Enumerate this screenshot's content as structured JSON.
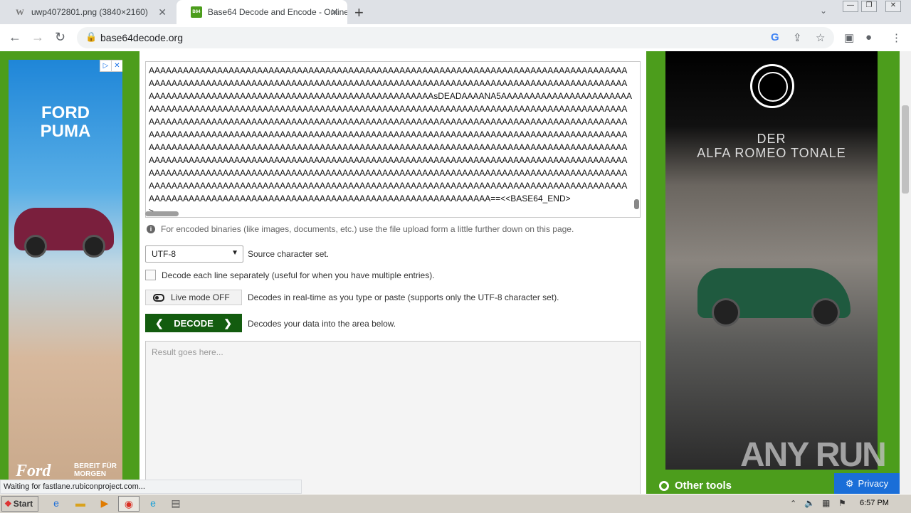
{
  "browser": {
    "tabs": [
      {
        "title": "uwp4072801.png (3840×2160)",
        "favicon": "W"
      },
      {
        "title": "Base64 Decode and Encode - Online",
        "favicon": "B64"
      }
    ],
    "url": "base64decode.org",
    "status_text": "Waiting for fastlane.rubiconproject.com..."
  },
  "editor": {
    "lines": [
      "AAAAAAAAAAAAAAAAAAAAAAAAAAAAAAAAAAAAAAAAAAAAAAAAAAAAAAAAAAAAAAAAAAAAAAAAAAAAAAAAAAAA",
      "AAAAAAAAAAAAAAAAAAAAAAAAAAAAAAAAAAAAAAAAAAAAAAAAAAAAAAAAAAAAAAAAAAAAAAAAAAAAAAAAAAAA",
      "AAAAAAAAAAAAAAAAAAAAAAAAAAAAAAAAAAAAAAAAAAAAAAAAAAsDEADAAAANA5AAAAAAAAAAAAAAAAAAAAAAA",
      "AAAAAAAAAAAAAAAAAAAAAAAAAAAAAAAAAAAAAAAAAAAAAAAAAAAAAAAAAAAAAAAAAAAAAAAAAAAAAAAAAAAA",
      "AAAAAAAAAAAAAAAAAAAAAAAAAAAAAAAAAAAAAAAAAAAAAAAAAAAAAAAAAAAAAAAAAAAAAAAAAAAAAAAAAAAA",
      "AAAAAAAAAAAAAAAAAAAAAAAAAAAAAAAAAAAAAAAAAAAAAAAAAAAAAAAAAAAAAAAAAAAAAAAAAAAAAAAAAAAA",
      "AAAAAAAAAAAAAAAAAAAAAAAAAAAAAAAAAAAAAAAAAAAAAAAAAAAAAAAAAAAAAAAAAAAAAAAAAAAAAAAAAAAA",
      "AAAAAAAAAAAAAAAAAAAAAAAAAAAAAAAAAAAAAAAAAAAAAAAAAAAAAAAAAAAAAAAAAAAAAAAAAAAAAAAAAAAA",
      "AAAAAAAAAAAAAAAAAAAAAAAAAAAAAAAAAAAAAAAAAAAAAAAAAAAAAAAAAAAAAAAAAAAAAAAAAAAAAAAAAAAA",
      "AAAAAAAAAAAAAAAAAAAAAAAAAAAAAAAAAAAAAAAAAAAAAAAAAAAAAAAAAAAAAAAAAAAAAAAAAAAAAAAAAAAA",
      "AAAAAAAAAAAAAAAAAAAAAAAAAAAAAAAAAAAAAAAAAAAAAAAAAAAAAAAAAAAA==<<BASE64_END>",
      ">"
    ]
  },
  "info_text": "For encoded binaries (like images, documents, etc.) use the file upload form a little further down on this page.",
  "charset": {
    "value": "UTF-8",
    "label": "Source character set."
  },
  "decode_each_line": {
    "label": "Decode each line separately (useful for when you have multiple entries).",
    "checked": false
  },
  "live_mode": {
    "label": "Live mode OFF",
    "description": "Decodes in real-time as you type or paste (supports only the UTF-8 character set)."
  },
  "decode_button": {
    "label": "DECODE",
    "description": "Decodes your data into the area below."
  },
  "result": {
    "placeholder": "Result goes here..."
  },
  "left_ad": {
    "title_line1": "FORD",
    "title_line2": "PUMA",
    "logo": "Ford",
    "slogan_line1": "BEREIT FÜR",
    "slogan_line2": "MORGEN"
  },
  "right_ad": {
    "logo": "ALFA ROMEO",
    "line1": "DER",
    "line2": "ALFA ROMEO TONALE"
  },
  "watermark": "ANY RUN",
  "other_tools": "Other tools",
  "privacy": "Privacy",
  "taskbar": {
    "start": "Start",
    "clock": "6:57 PM"
  }
}
